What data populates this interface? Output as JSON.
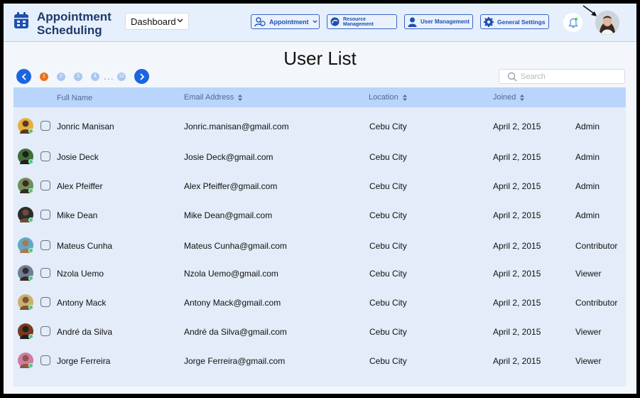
{
  "app": {
    "title": "Appointment Scheduling",
    "colors": {
      "accent": "#1a66e0",
      "header_bg": "#e6effc",
      "admin": "#e0262d",
      "contributor": "#3a55a2"
    }
  },
  "header": {
    "dashboard_select": "Dashboard",
    "nav": {
      "appointment": "Appointment",
      "resource": "Resource Management",
      "users": "User Management",
      "settings": "General Settings"
    }
  },
  "page": {
    "title": "User List"
  },
  "pagination": {
    "pages": [
      "1",
      "2",
      "3",
      "4"
    ],
    "dots": "...",
    "last": "10",
    "current": "1"
  },
  "search": {
    "placeholder": "Search",
    "value": ""
  },
  "table": {
    "columns": [
      "Full Name",
      "Email Address",
      "Location",
      "Joined"
    ],
    "rows": [
      {
        "name": "Jonric Manisan",
        "email": "Jonric.manisan@gmail.com",
        "location": "Cebu City",
        "joined": "April 2, 2015",
        "role": "Admin",
        "role_type": "admin"
      },
      {
        "name": "Josie Deck",
        "email": "Josie Deck@gmail.com",
        "location": "Cebu City",
        "joined": "April 2, 2015",
        "role": "Admin",
        "role_type": "admin"
      },
      {
        "name": "Alex Pfeiffer",
        "email": "Alex Pfeiffer@gmail.com",
        "location": "Cebu City",
        "joined": "April 2, 2015",
        "role": "Admin",
        "role_type": "admin"
      },
      {
        "name": "Mike Dean",
        "email": "Mike Dean@gmail.com",
        "location": "Cebu City",
        "joined": "April 2, 2015",
        "role": "Admin",
        "role_type": "admin"
      },
      {
        "name": "Mateus Cunha",
        "email": "Mateus Cunha@gmail.com",
        "location": "Cebu City",
        "joined": "April 2, 2015",
        "role": "Contributor",
        "role_type": "contributor"
      },
      {
        "name": "Nzola Uemo",
        "email": "Nzola Uemo@gmail.com",
        "location": "Cebu City",
        "joined": "April 2, 2015",
        "role": "Viewer",
        "role_type": "viewer"
      },
      {
        "name": "Antony Mack",
        "email": "Antony Mack@gmail.com",
        "location": "Cebu City",
        "joined": "April 2, 2015",
        "role": "Contributor",
        "role_type": "contributor"
      },
      {
        "name": "André da Silva",
        "email": "André da Silva@gmail.com",
        "location": "Cebu City",
        "joined": "April 2, 2015",
        "role": "Viewer",
        "role_type": "viewer"
      },
      {
        "name": "Jorge Ferreira",
        "email": "Jorge Ferreira@gmail.com",
        "location": "Cebu City",
        "joined": "April 2, 2015",
        "role": "Viewer",
        "role_type": "viewer"
      }
    ]
  }
}
